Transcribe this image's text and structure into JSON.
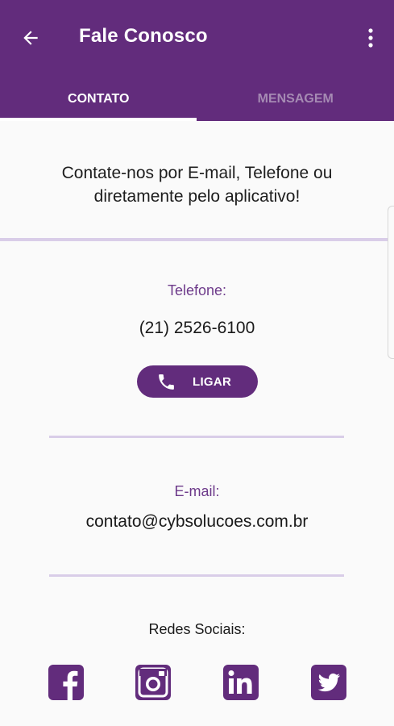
{
  "header": {
    "title": "Fale Conosco",
    "back_icon": "arrow-left-icon",
    "menu_icon": "more-vertical-icon"
  },
  "tabs": [
    {
      "label": "CONTATO",
      "active": true
    },
    {
      "label": "MENSAGEM",
      "active": false
    }
  ],
  "intro": {
    "line1": "Contate-nos por E-mail, Telefone ou",
    "line2": "diretamente pelo aplicativo!"
  },
  "phone": {
    "label": "Telefone:",
    "value": "(21) 2526-6100",
    "button_label": "LIGAR",
    "button_icon": "phone-icon"
  },
  "email": {
    "label": "E-mail:",
    "value": "contato@cybsolucoes.com.br"
  },
  "social": {
    "label": "Redes Sociais:",
    "networks": [
      "facebook-icon",
      "instagram-icon",
      "linkedin-icon",
      "twitter-icon"
    ]
  },
  "colors": {
    "primary": "#622c7c",
    "accent_text": "#6d3a8a",
    "divider": "#d9cde8",
    "background": "#fafafa",
    "tab_inactive": "#a58ab3"
  }
}
